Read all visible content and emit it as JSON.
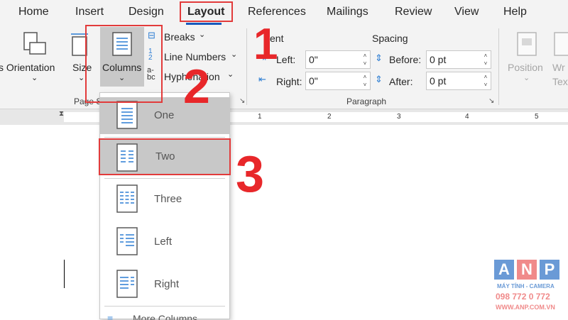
{
  "tabs": [
    "Home",
    "Insert",
    "Design",
    "Layout",
    "References",
    "Mailings",
    "Review",
    "View",
    "Help"
  ],
  "active_tab": "Layout",
  "page_setup": {
    "orientation_label": "s Orientation",
    "size_label": "Size",
    "columns_label": "Columns",
    "breaks_label": "Breaks",
    "line_numbers_label": "Line Numbers",
    "hyphenation_label": "Hyphenation",
    "group_label": "Page S"
  },
  "paragraph": {
    "indent_header": "ent",
    "spacing_header": "Spacing",
    "left_label": "Left:",
    "left_value": "0\"",
    "right_label": "Right:",
    "right_value": "0\"",
    "before_label": "Before:",
    "before_value": "0 pt",
    "after_label": "After:",
    "after_value": "0 pt",
    "group_label": "Paragraph"
  },
  "arrange": {
    "position_label": "Position",
    "wrap_label": "Wr",
    "text_label": "Tex"
  },
  "ruler_numbers": [
    "1",
    "2",
    "3",
    "4",
    "5"
  ],
  "columns_menu": {
    "items": [
      {
        "label": "One"
      },
      {
        "label": "Two"
      },
      {
        "label": "Three"
      },
      {
        "label": "Left"
      },
      {
        "label": "Right"
      }
    ],
    "more_label": "More Columns..."
  },
  "annotations": [
    "1",
    "2",
    "3"
  ],
  "watermark": {
    "letters": [
      "A",
      "N",
      "P"
    ],
    "line1": "MÁY TÍNH - CAMERA",
    "phone": "098 772 0 772",
    "site": "WWW.ANP.COM.VN"
  },
  "colors": {
    "annotation_red": "#e8272a",
    "accent_blue": "#185abd",
    "anp_blue": "#2f66b3",
    "anp_red": "#e23b3b"
  }
}
